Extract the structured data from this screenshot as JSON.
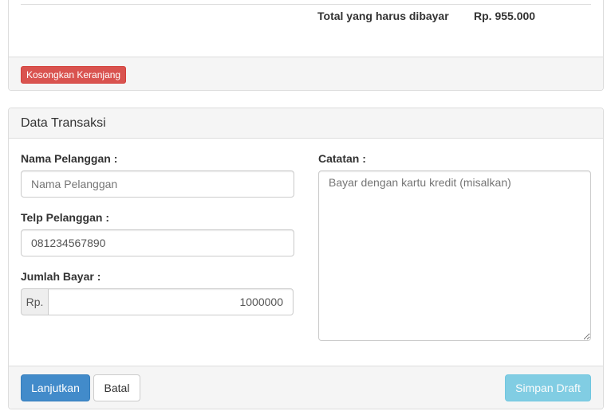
{
  "cart": {
    "total_label": "Total yang harus dibayar",
    "total_value": "Rp. 955.000",
    "empty_cart_label": "Kosongkan Keranjang"
  },
  "transaction": {
    "title": "Data Transaksi",
    "customer_name_label": "Nama Pelanggan :",
    "customer_name_placeholder": "Nama Pelanggan",
    "customer_phone_label": "Telp Pelanggan :",
    "customer_phone_value": "081234567890",
    "payment_label": "Jumlah Bayar :",
    "payment_prefix": "Rp.",
    "payment_value": "1000000",
    "notes_label": "Catatan :",
    "notes_placeholder": "Bayar dengan kartu kredit (misalkan)"
  },
  "actions": {
    "continue_label": "Lanjutkan",
    "cancel_label": "Batal",
    "save_draft_label": "Simpan Draft"
  },
  "colors": {
    "primary": "#428bca",
    "danger": "#d9534f",
    "info": "#5bc0de"
  }
}
